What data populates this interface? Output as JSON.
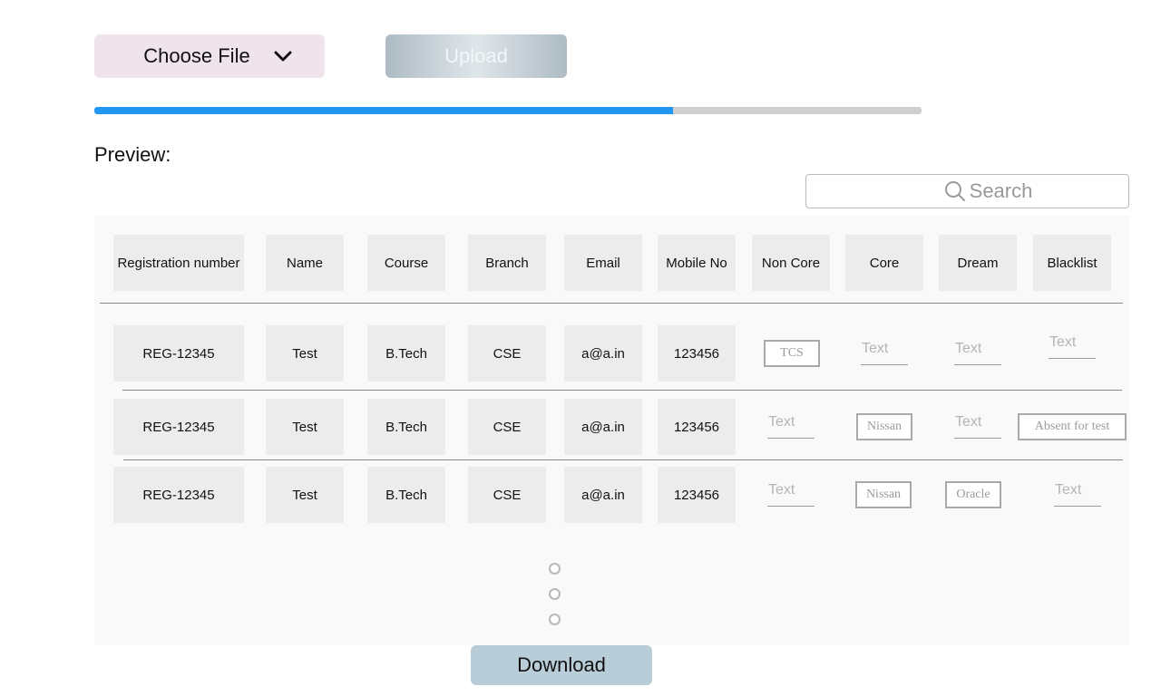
{
  "controls": {
    "choose_file_label": "Choose File",
    "upload_label": "Upload",
    "progress_fraction": 0.7,
    "progress_color": "#2196f3"
  },
  "preview_label": "Preview:",
  "search": {
    "placeholder": "Search"
  },
  "table": {
    "headers": [
      "Registration number",
      "Name",
      "Course",
      "Branch",
      "Email",
      "Mobile No",
      "Non Core",
      "Core",
      "Dream",
      "Blacklist"
    ],
    "rows": [
      {
        "reg": "REG-12345",
        "name": "Test",
        "course": "B.Tech",
        "branch": "CSE",
        "email": "a@a.in",
        "mobile": "123456",
        "non_core": "TCS",
        "core": "Text",
        "dream": "Text",
        "blacklist": "Text"
      },
      {
        "reg": "REG-12345",
        "name": "Test",
        "course": "B.Tech",
        "branch": "CSE",
        "email": "a@a.in",
        "mobile": "123456",
        "non_core": "Text",
        "core": "Nissan",
        "dream": "Text",
        "blacklist": "Absent for test"
      },
      {
        "reg": "REG-12345",
        "name": "Test",
        "course": "B.Tech",
        "branch": "CSE",
        "email": "a@a.in",
        "mobile": "123456",
        "non_core": "Text",
        "core": "Nissan",
        "dream": "Oracle",
        "blacklist": "Text"
      }
    ]
  },
  "pagination": {
    "dots": 3
  },
  "download_label": "Download"
}
